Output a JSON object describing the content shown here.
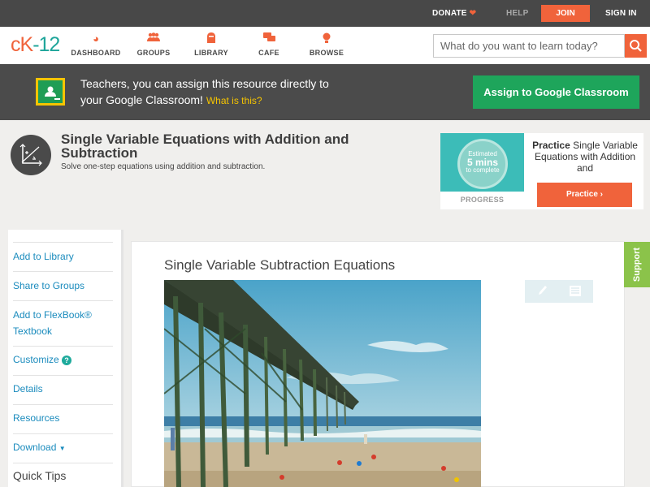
{
  "topbar": {
    "donate": "DONATE",
    "help": "HELP",
    "join": "JOIN",
    "signin": "SIGN IN"
  },
  "logo": {
    "prefix": "cK",
    "suffix": "-12"
  },
  "nav": [
    {
      "label": "DASHBOARD",
      "icon": "dashboard-icon"
    },
    {
      "label": "GROUPS",
      "icon": "groups-icon"
    },
    {
      "label": "LIBRARY",
      "icon": "library-icon"
    },
    {
      "label": "CAFE",
      "icon": "cafe-icon"
    },
    {
      "label": "BROWSE",
      "icon": "browse-icon"
    }
  ],
  "search": {
    "placeholder": "What do you want to learn today?"
  },
  "banner": {
    "line1": "Teachers, you can assign this resource directly to",
    "line2": "your Google Classroom!",
    "what": "What is this?",
    "button": "Assign to Google Classroom"
  },
  "concept": {
    "title": "Single Variable Equations with Addition and Subtraction",
    "subtitle": "Solve one-step equations using addition and subtraction."
  },
  "practice": {
    "estimated": "Estimated",
    "mins": "5 mins",
    "complete": "to complete",
    "progress": "PROGRESS",
    "bold": "Practice",
    "text": "Single Variable Equations with Addition and",
    "button": "Practice"
  },
  "sidebar": {
    "items": [
      "Add to Library",
      "Share to Groups",
      "Add to FlexBook®",
      "Textbook",
      "Customize",
      "Details",
      "Resources",
      "Download"
    ],
    "quick_tips": "Quick Tips"
  },
  "main": {
    "title": "Single Variable Subtraction Equations"
  },
  "support": "Support",
  "colors": {
    "accent": "#f0633b",
    "green": "#1ea55b",
    "link": "#1a8bbd",
    "support": "#8bc34a"
  }
}
